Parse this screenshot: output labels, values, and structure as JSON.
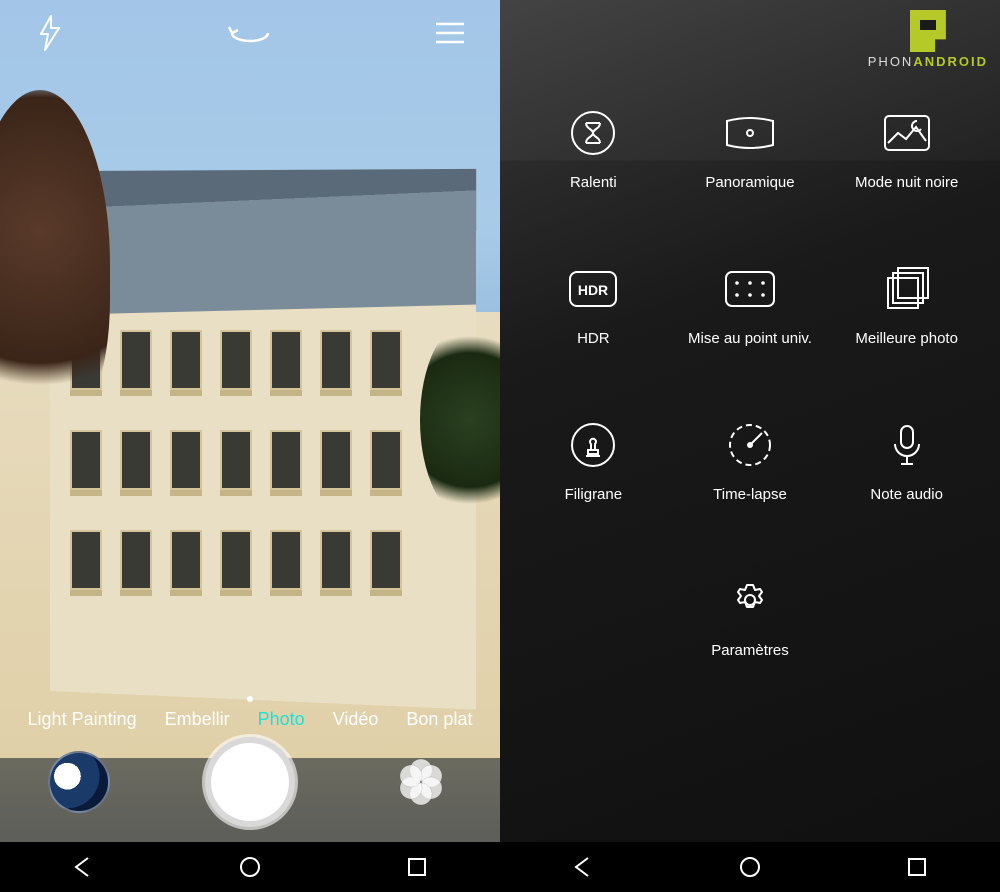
{
  "left": {
    "topbar": {
      "flash": "flash-icon",
      "switch": "switch-camera-icon",
      "menu": "menu-icon"
    },
    "modes": [
      {
        "label": "Light Painting",
        "active": false
      },
      {
        "label": "Embellir",
        "active": false
      },
      {
        "label": "Photo",
        "active": true
      },
      {
        "label": "Vidéo",
        "active": false
      },
      {
        "label": "Bon plat",
        "active": false
      }
    ],
    "controls": {
      "thumbnail": "gallery-thumbnail",
      "shutter": "shutter-button",
      "effects": "effects-button"
    }
  },
  "right": {
    "watermark": {
      "text_a": "PHON",
      "text_b": "ANDROID"
    },
    "modes": [
      {
        "label": "Ralenti",
        "icon": "hourglass"
      },
      {
        "label": "Panoramique",
        "icon": "panorama"
      },
      {
        "label": "Mode nuit noire",
        "icon": "night"
      },
      {
        "label": "HDR",
        "icon": "hdr"
      },
      {
        "label": "Mise au point univ.",
        "icon": "focus"
      },
      {
        "label": "Meilleure photo",
        "icon": "best"
      },
      {
        "label": "Filigrane",
        "icon": "stamp"
      },
      {
        "label": "Time-lapse",
        "icon": "timelapse"
      },
      {
        "label": "Note audio",
        "icon": "mic"
      },
      {
        "label": "Paramètres",
        "icon": "settings"
      }
    ]
  },
  "nav": {
    "back": "back-button",
    "home": "home-button",
    "recents": "recents-button"
  },
  "colors": {
    "accent": "#1de0d8",
    "brand": "#b5c928"
  }
}
